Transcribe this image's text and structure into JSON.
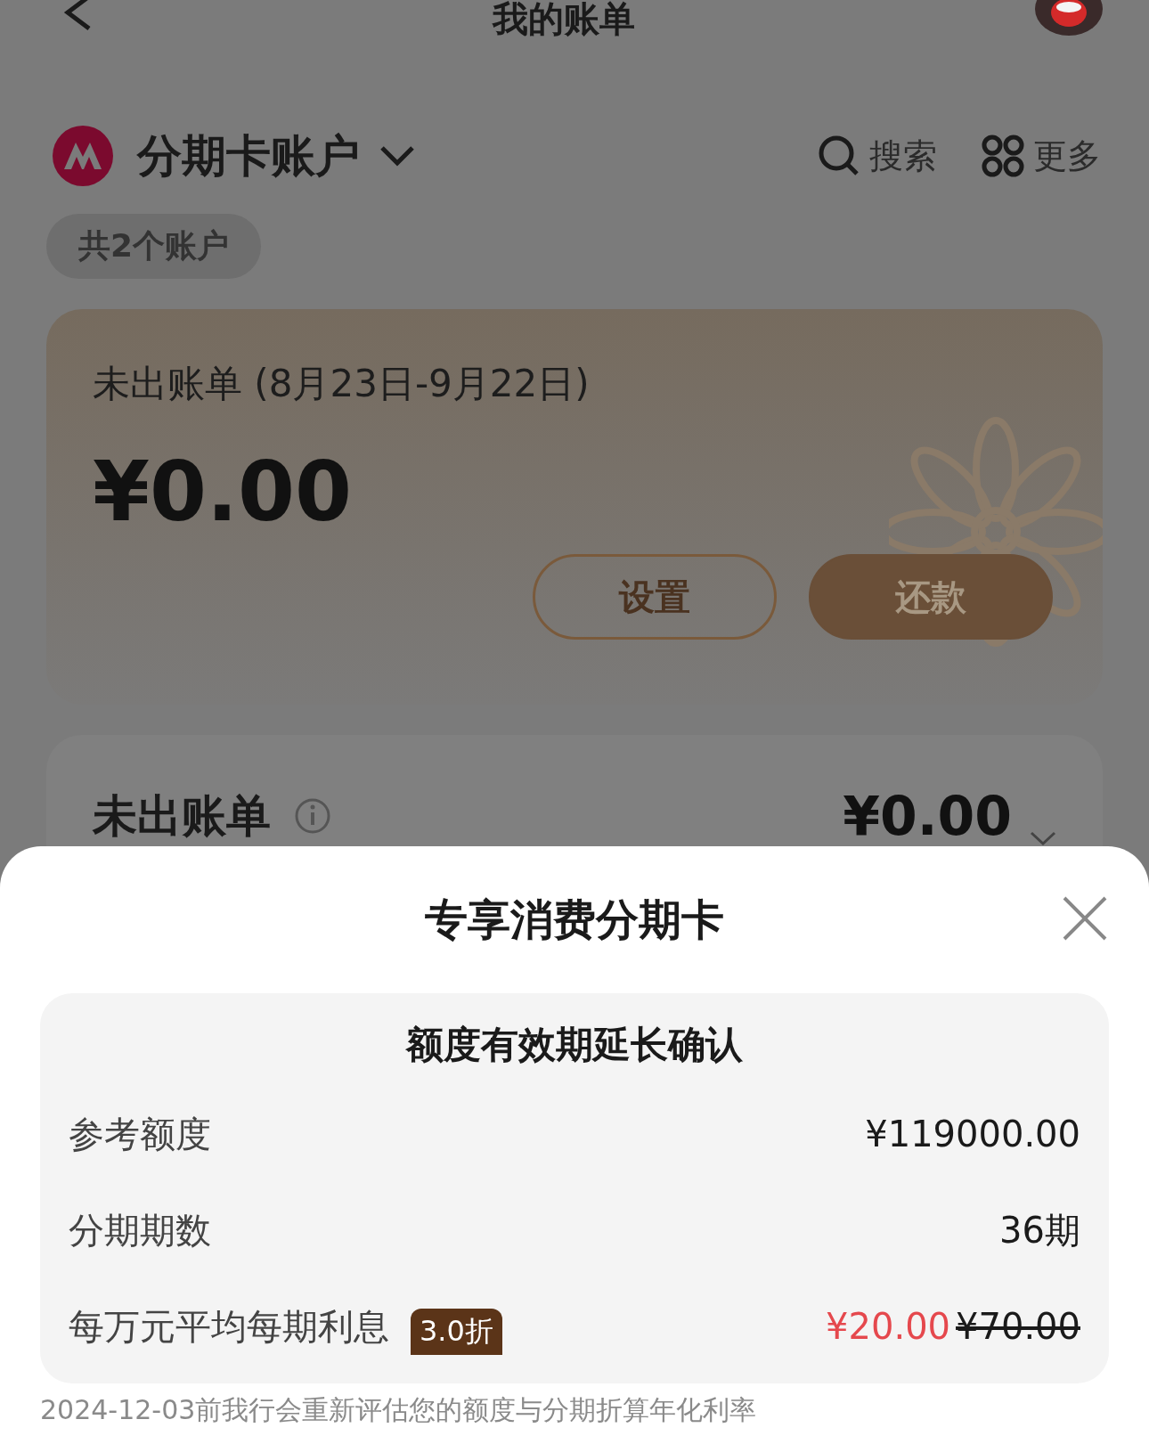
{
  "header": {
    "title": "我的账单"
  },
  "account": {
    "name": "分期卡账户",
    "search": "搜索",
    "more": "更多",
    "count": "共2个账户"
  },
  "bill_card": {
    "title": "未出账单 (8月23日-9月22日)",
    "amount": "¥0.00",
    "buttons": [
      {
        "label": "设置",
        "kind": "outline"
      },
      {
        "label": "还款",
        "kind": "filled"
      }
    ]
  },
  "summary_card": {
    "title": "未出账单",
    "amount": "¥0.00"
  },
  "sheet": {
    "title": "专享消费分期卡",
    "panel_title": "额度有效期延长确认",
    "rows": [
      {
        "label": "参考额度",
        "value": "¥119000.00"
      },
      {
        "label": "分期期数",
        "value": "36期"
      },
      {
        "label": "每万元平均每期利息",
        "badge": "3.0折",
        "value": "¥20.00",
        "original_value": "¥70.00"
      }
    ],
    "note": "2024-12-03前我行会重新评估您的额度与分期折算年化利率"
  }
}
